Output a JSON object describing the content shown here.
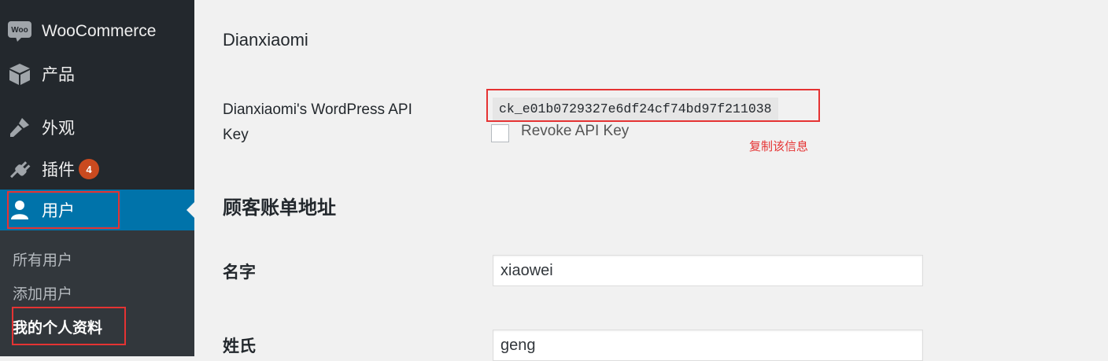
{
  "sidebar": {
    "items": [
      {
        "label": "WooCommerce",
        "icon": "woo-icon"
      },
      {
        "label": "产品",
        "icon": "box-icon"
      },
      {
        "label": "外观",
        "icon": "paintbrush-icon"
      },
      {
        "label": "插件",
        "icon": "plugin-icon",
        "badge": "4"
      },
      {
        "label": "用户",
        "icon": "user-icon",
        "active": true
      }
    ],
    "woo_logo_text": "Woo",
    "submenu": [
      "所有用户",
      "添加用户",
      "我的个人资料"
    ],
    "active_color": "#0073aa",
    "badge_color": "#ca4a1f"
  },
  "main": {
    "dianxiaomi": {
      "title": "Dianxiaomi",
      "api_key_label": "Dianxiaomi's WordPress API Key",
      "api_key_label_line1": "Dianxiaomi's WordPress API",
      "api_key_label_line2": "Key",
      "api_key_value": "ck_e01b0729327e6df24cf74bd97f211038",
      "revoke_label": "Revoke API Key",
      "revoke_checked": false
    },
    "annotation": "复制该信息",
    "billing": {
      "title": "顾客账单地址",
      "first_name_label": "名字",
      "first_name_value": "xiaowei",
      "last_name_label": "姓氏",
      "last_name_value": "geng"
    }
  },
  "highlight_color": "#e53333"
}
